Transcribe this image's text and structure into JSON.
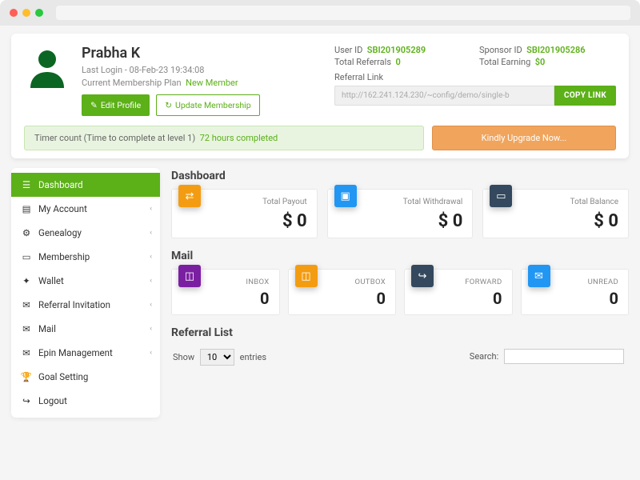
{
  "profile": {
    "name": "Prabha K",
    "last_login_label": "Last Login - 08-Feb-23 19:34:08",
    "plan_label": "Current Membership Plan",
    "plan_value": "New Member",
    "edit_btn": "Edit Profile",
    "update_btn": "Update Membership",
    "userid_label": "User ID",
    "userid_value": "SBI201905289",
    "sponsor_label": "Sponsor ID",
    "sponsor_value": "SBI201905286",
    "referrals_label": "Total Referrals",
    "referrals_value": "0",
    "earning_label": "Total Earning",
    "earning_value": "$0",
    "reflink_label": "Referral Link",
    "reflink_value": "http://162.241.124.230/~config/demo/single-b",
    "copy_btn": "COPY LINK",
    "timer_label": "Timer count (Time to complete at level 1)",
    "timer_value": "72 hours completed",
    "upgrade_btn": "Kindly Upgrade Now..."
  },
  "nav": {
    "dashboard": "Dashboard",
    "my_account": "My Account",
    "genealogy": "Genealogy",
    "membership": "Membership",
    "wallet": "Wallet",
    "referral_invitation": "Referral Invitation",
    "mail": "Mail",
    "epin": "Epin Management",
    "goal_setting": "Goal Setting",
    "logout": "Logout"
  },
  "dashboard": {
    "section_title": "Dashboard",
    "payout_label": "Total Payout",
    "payout_value": "$ 0",
    "withdrawal_label": "Total Withdrawal",
    "withdrawal_value": "$ 0",
    "balance_label": "Total Balance",
    "balance_value": "$ 0"
  },
  "mail": {
    "section_title": "Mail",
    "inbox_label": "INBOX",
    "inbox_value": "0",
    "outbox_label": "OUTBOX",
    "outbox_value": "0",
    "forward_label": "FORWARD",
    "forward_value": "0",
    "unread_label": "UNREAD",
    "unread_value": "0"
  },
  "referral_list": {
    "section_title": "Referral List",
    "show_label": "Show",
    "entries_label": "entries",
    "page_size": "10",
    "search_label": "Search:"
  }
}
